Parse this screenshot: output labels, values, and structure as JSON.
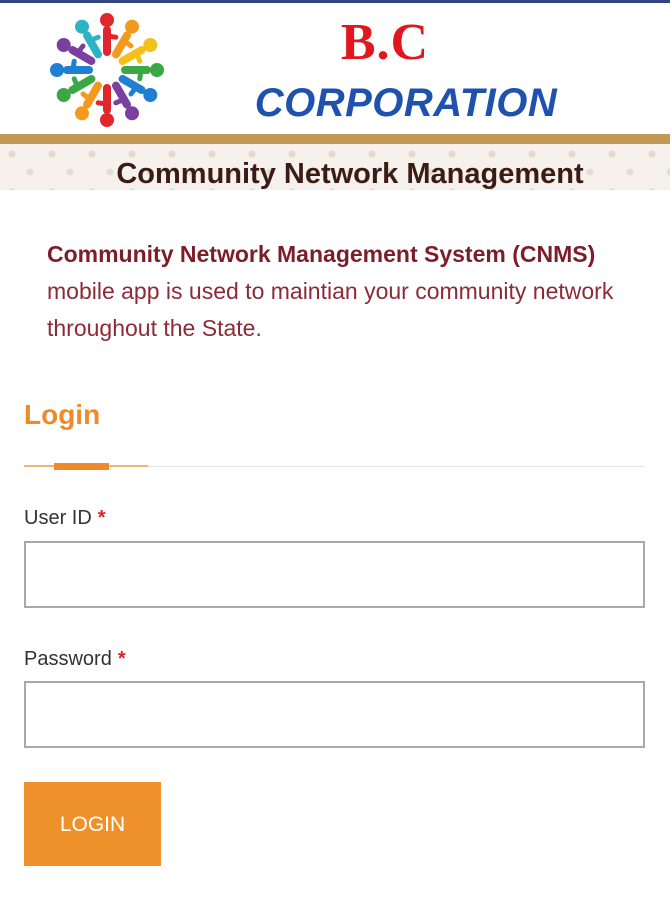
{
  "brand": {
    "title": "B.C",
    "subtitle": "CORPORATION"
  },
  "header": {
    "app_title": "Community Network Management"
  },
  "intro": {
    "bold": "Community Network Management System (CNMS)",
    "line2": "mobile app is used to maintian your community network",
    "line3": "throughout the State."
  },
  "login": {
    "heading": "Login",
    "user_id_label": "User ID",
    "password_label": "Password",
    "required_mark": "*",
    "user_id_value": "",
    "password_value": "",
    "button_label": "LOGIN"
  },
  "colors": {
    "brand_red": "#e3151d",
    "brand_blue": "#1f52ad",
    "accent_orange": "#ee8a2c",
    "maroon": "#8b2b37"
  },
  "icons": {
    "logo": "people-circle-logo"
  }
}
